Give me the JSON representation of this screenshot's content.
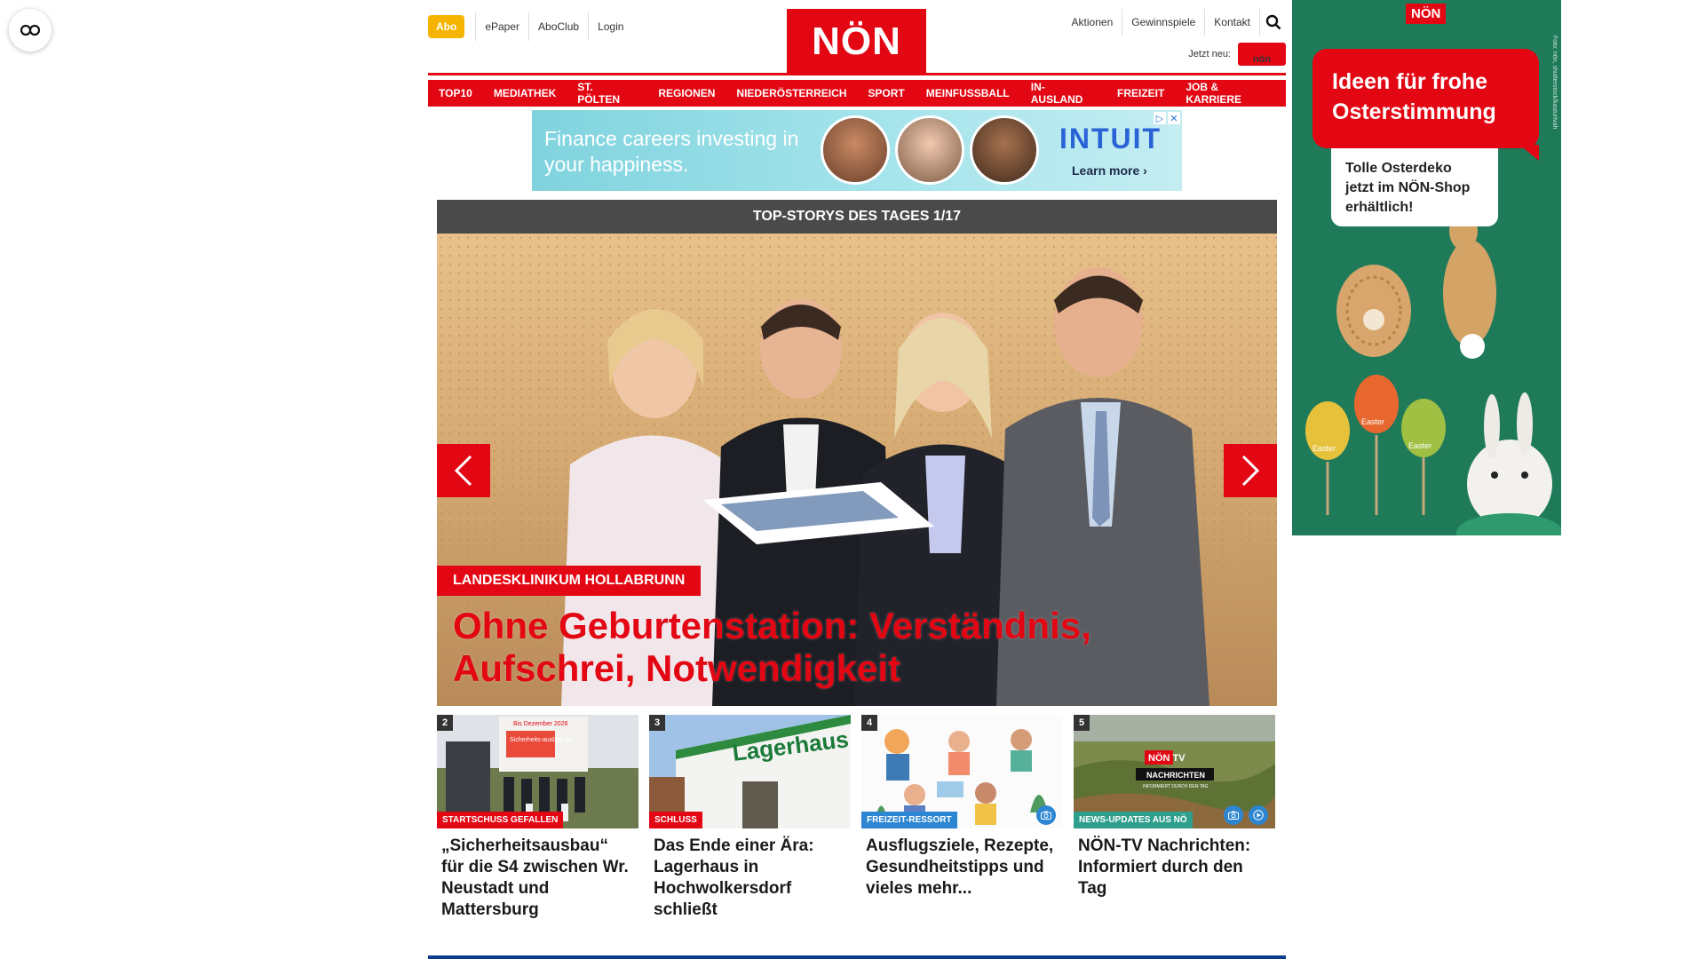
{
  "header": {
    "abo_label": "Abo",
    "top_links": [
      "ePaper",
      "AboClub",
      "Login"
    ],
    "logo_text": "NÖN",
    "right_links": [
      "Aktionen",
      "Gewinnspiele",
      "Kontakt"
    ],
    "jetzt_neu_label": "Jetzt neu:",
    "badge_text": "nön"
  },
  "nav": {
    "items": [
      "TOP10",
      "MEDIATHEK",
      "ST. PÖLTEN",
      "REGIONEN",
      "NIEDERÖSTERREICH",
      "SPORT",
      "MEINFUSSBALL",
      "IN-AUSLAND",
      "FREIZEIT",
      "JOB & KARRIERE"
    ]
  },
  "ad_banner": {
    "headline": "Finance careers investing in your happiness.",
    "brand": "INTUIT",
    "cta": "Learn more ›",
    "close": "✕"
  },
  "hero": {
    "section_title": "TOP-STORYS DES TAGES 1/17",
    "kicker": "LANDESKLINIKUM HOLLABRUNN",
    "title": "Ohne Geburtenstation: Verständnis, Aufschrei, Notwendigkeit"
  },
  "teasers": [
    {
      "number": "2",
      "category": "STARTSCHUSS GEFALLEN",
      "title": "„Sicherheitsausbau“ für die S4 zwischen Wr. Neustadt und Mattersburg",
      "image_sign": "Sicherheits-ausbau S4",
      "image_date": "Bis Dezember 2026"
    },
    {
      "number": "3",
      "category": "SCHLUSS",
      "title": "Das Ende einer Ära: Lagerhaus in Hochwolkersdorf schließt",
      "image_sign": "Lagerhaus"
    },
    {
      "number": "4",
      "category": "FREIZEIT-RESSORT",
      "title": "Ausflugsziele, Rezepte, Gesundheitstipps und vieles mehr...",
      "icons": [
        "camera-icon"
      ]
    },
    {
      "number": "5",
      "category": "NEWS-UPDATES AUS NÖ",
      "title": "NÖN-TV Nachrichten: Informiert durch den Tag",
      "image_logo": "NÖN TV",
      "image_banner": "NACHRICHTEN",
      "image_tagline": "INFORMIERT DURCH DEN TAG",
      "icons": [
        "camera-icon",
        "play-icon"
      ]
    }
  ],
  "side_ad": {
    "logo": "NÖN",
    "headline": "Ideen für frohe Osterstimmung",
    "subline": "Tolle Osterdeko jetzt im NÖN-Shop erhältlich!",
    "credit": "Foto: nön, shutterstock/kasturtvah",
    "egg_text": "Easter"
  },
  "colors": {
    "brand_red": "#e30613",
    "abo_yellow": "#f5b400",
    "hero_header": "#4a4a4a",
    "teal": "#2f9f8d",
    "blue": "#2c86d1",
    "bottom_bar": "#0b3c8c",
    "side_ad_green": "#1f7a5a"
  }
}
